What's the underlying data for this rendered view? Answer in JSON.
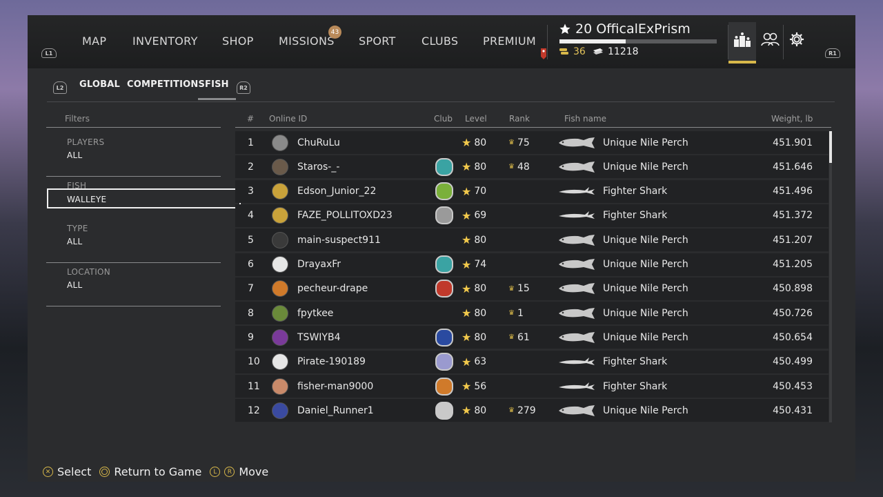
{
  "nav": {
    "left_bumper": "L1",
    "right_bumper": "R1",
    "items": [
      "MAP",
      "INVENTORY",
      "SHOP",
      "MISSIONS",
      "SPORT",
      "CLUBS",
      "PREMIUM"
    ],
    "missions_badge": "43"
  },
  "player": {
    "name": "20 OfficalExPrism",
    "xp_progress": 0.42,
    "coins": "36",
    "credits": "11218"
  },
  "icons": {
    "leaderboard": "leaderboard-icon",
    "friends": "friends-icon",
    "settings": "gear-icon"
  },
  "subtabs": {
    "left_trigger": "L2",
    "right_trigger": "R2",
    "items": [
      "GLOBAL",
      "COMPETITIONS",
      "FISH"
    ],
    "active": "FISH"
  },
  "filters": {
    "title": "Filters",
    "items": [
      {
        "label": "PLAYERS",
        "value": "ALL"
      },
      {
        "label": "FISH",
        "value": "WALLEYE"
      },
      {
        "label": "TYPE",
        "value": "ALL"
      },
      {
        "label": "LOCATION",
        "value": "ALL"
      }
    ]
  },
  "table": {
    "headers": [
      "#",
      "Online ID",
      "Club",
      "Level",
      "Rank",
      "Fish name",
      "Weight, lb"
    ],
    "rows": [
      {
        "num": "1",
        "id": "ChuRuLu",
        "level": "80",
        "rank": "75",
        "fish": "Unique Nile Perch",
        "weight": "451.901"
      },
      {
        "num": "2",
        "id": "Staros-_-",
        "level": "80",
        "rank": "48",
        "fish": "Unique Nile Perch",
        "weight": "451.646"
      },
      {
        "num": "3",
        "id": "Edson_Junior_22",
        "level": "70",
        "rank": "",
        "fish": "Fighter Shark",
        "weight": "451.496"
      },
      {
        "num": "4",
        "id": "FAZE_POLLITOXD23",
        "level": "69",
        "rank": "",
        "fish": "Fighter Shark",
        "weight": "451.372"
      },
      {
        "num": "5",
        "id": "main-suspect911",
        "level": "80",
        "rank": "",
        "fish": "Unique Nile Perch",
        "weight": "451.207"
      },
      {
        "num": "6",
        "id": "DrayaxFr",
        "level": "74",
        "rank": "",
        "fish": "Unique Nile Perch",
        "weight": "451.205"
      },
      {
        "num": "7",
        "id": "pecheur-drape",
        "level": "80",
        "rank": "15",
        "fish": "Unique Nile Perch",
        "weight": "450.898"
      },
      {
        "num": "8",
        "id": "fpytkee",
        "level": "80",
        "rank": "1",
        "fish": "Unique Nile Perch",
        "weight": "450.726"
      },
      {
        "num": "9",
        "id": "TSWIYB4",
        "level": "80",
        "rank": "61",
        "fish": "Unique Nile Perch",
        "weight": "450.654"
      },
      {
        "num": "10",
        "id": "Pirate-190189",
        "level": "63",
        "rank": "",
        "fish": "Fighter Shark",
        "weight": "450.499"
      },
      {
        "num": "11",
        "id": "fisher-man9000",
        "level": "56",
        "rank": "",
        "fish": "Fighter Shark",
        "weight": "450.453"
      },
      {
        "num": "12",
        "id": "Daniel_Runner1",
        "level": "80",
        "rank": "279",
        "fish": "Unique Nile Perch",
        "weight": "450.431"
      }
    ]
  },
  "footer": {
    "select": "Select",
    "return": "Return to Game",
    "move": "Move",
    "l_btn": "L",
    "r_btn": "R"
  },
  "colors": {
    "accent": "#d8b84a",
    "panel": "#2b2c2e",
    "row": "#212224"
  }
}
